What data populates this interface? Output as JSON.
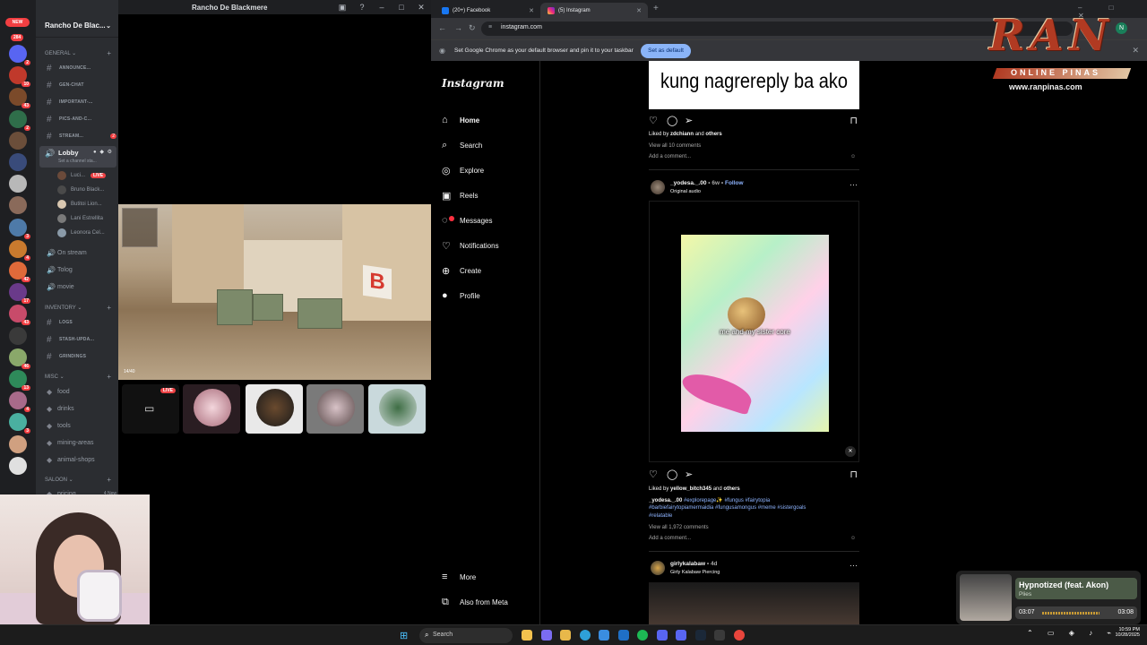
{
  "discord": {
    "title": "Rancho De Blackmere",
    "new_label": "NEW",
    "mentions_total": "284",
    "server_name": "Rancho De Blac...",
    "server_badges": [
      "2",
      "10",
      "43",
      "2",
      "",
      "",
      "",
      "",
      "3",
      "4",
      "42",
      "17",
      "43",
      "",
      "46",
      "13",
      "4",
      "3",
      "",
      ""
    ],
    "categories": {
      "general": "GENERAL",
      "inventory": "INVENTORY",
      "misc": "MISC",
      "saloon": "SALOON"
    },
    "general_channels": [
      {
        "name": "ANNOUNCE...",
        "badge": ""
      },
      {
        "name": "GEN-CHAT",
        "badge": ""
      },
      {
        "name": "IMPORTANT-...",
        "badge": ""
      },
      {
        "name": "PICS-AND-C...",
        "badge": ""
      },
      {
        "name": "STREAM...",
        "badge": "2"
      }
    ],
    "lobby": {
      "name": "Lobby",
      "status": "Set a channel sta..."
    },
    "voice_users": [
      {
        "name": "Luci...",
        "live": "LIVE"
      },
      {
        "name": "Bruno Black...",
        "live": ""
      },
      {
        "name": "Butitoi Lion...",
        "live": ""
      },
      {
        "name": "Lani Estrellita",
        "live": ""
      },
      {
        "name": "Leonora Cel...",
        "live": ""
      }
    ],
    "voice_channels": [
      "On stream",
      "Tolog",
      "movie"
    ],
    "inventory_channels": [
      "LOGS",
      "STASH-UPDA...",
      "GRINDINGS"
    ],
    "misc_channels": [
      "food",
      "drinks",
      "tools",
      "mining-areas",
      "animal-shops"
    ],
    "saloon_channels": [
      {
        "name": "pricing",
        "meta": "4 New"
      }
    ],
    "stream_live_label": "LIVE",
    "game_sign": "B",
    "hud_ammo": "14/40"
  },
  "chrome": {
    "tabs": [
      {
        "label": "(20+) Facebook",
        "active": false
      },
      {
        "label": "(5) Instagram",
        "active": true
      }
    ],
    "url": "instagram.com",
    "infobar": {
      "message": "Set Google Chrome as your default browser and pin it to your taskbar",
      "button": "Set as default"
    },
    "profile_initial": "N"
  },
  "instagram": {
    "logo": "Instagram",
    "nav": [
      {
        "label": "Home",
        "icon": "home-icon",
        "glyph": "⌂",
        "active": true
      },
      {
        "label": "Search",
        "icon": "search-icon",
        "glyph": "⌕"
      },
      {
        "label": "Explore",
        "icon": "compass-icon",
        "glyph": "◎"
      },
      {
        "label": "Reels",
        "icon": "reels-icon",
        "glyph": "▣"
      },
      {
        "label": "Messages",
        "icon": "messenger-icon",
        "glyph": "◌"
      },
      {
        "label": "Notifications",
        "icon": "heart-icon",
        "glyph": "♡"
      },
      {
        "label": "Create",
        "icon": "plus-square-icon",
        "glyph": "⊕"
      },
      {
        "label": "Profile",
        "icon": "avatar-icon",
        "glyph": "●"
      }
    ],
    "bottom_nav": [
      {
        "label": "More",
        "icon": "menu-icon",
        "glyph": "≡"
      },
      {
        "label": "Also from Meta",
        "icon": "meta-icon",
        "glyph": "⧉"
      }
    ],
    "post1": {
      "image_text": "kung nagrereply ba ako",
      "liked_by_user": "zdchiann",
      "liked_others": "others",
      "view_comments": "View all 10 comments",
      "add_comment": "Add a comment..."
    },
    "post2": {
      "username": "_yodesa._.00",
      "age": "6w",
      "follow": "Follow",
      "audio": "Original audio",
      "caption_overlay": "me and my sister core",
      "liked_by_user": "yellow_bitch345",
      "liked_others": "others",
      "caption_user": "_yodesa._.00",
      "caption_tags_1": "#explorepage✨ #fungus #fairytopia",
      "caption_tags_2": "#barbiefairytopiamermaidia #fungusamongus #meme #sistergoals",
      "caption_tags_3": "#relatable",
      "view_comments": "View all 1,972 comments",
      "add_comment": "Add a comment..."
    },
    "post3": {
      "username": "girlykalabaw",
      "age": "4d",
      "subtitle": "Girly Kalabaw Piercing"
    }
  },
  "watermark": {
    "title": "RAN",
    "subtitle": "ONLINE PINAS",
    "url": "www.ranpinas.com"
  },
  "media_player": {
    "song": "Hypnotized (feat. Akon)",
    "artist": "Plies",
    "current": "03:07",
    "duration": "03:08"
  },
  "taskbar": {
    "search_placeholder": "Search",
    "clock_time": "10:59 PM",
    "clock_date": "10/28/2025"
  },
  "colors": {
    "discord_accent": "#f23f42",
    "ig_blue": "#8eb4ff",
    "chrome_button": "#8ab4f8"
  }
}
